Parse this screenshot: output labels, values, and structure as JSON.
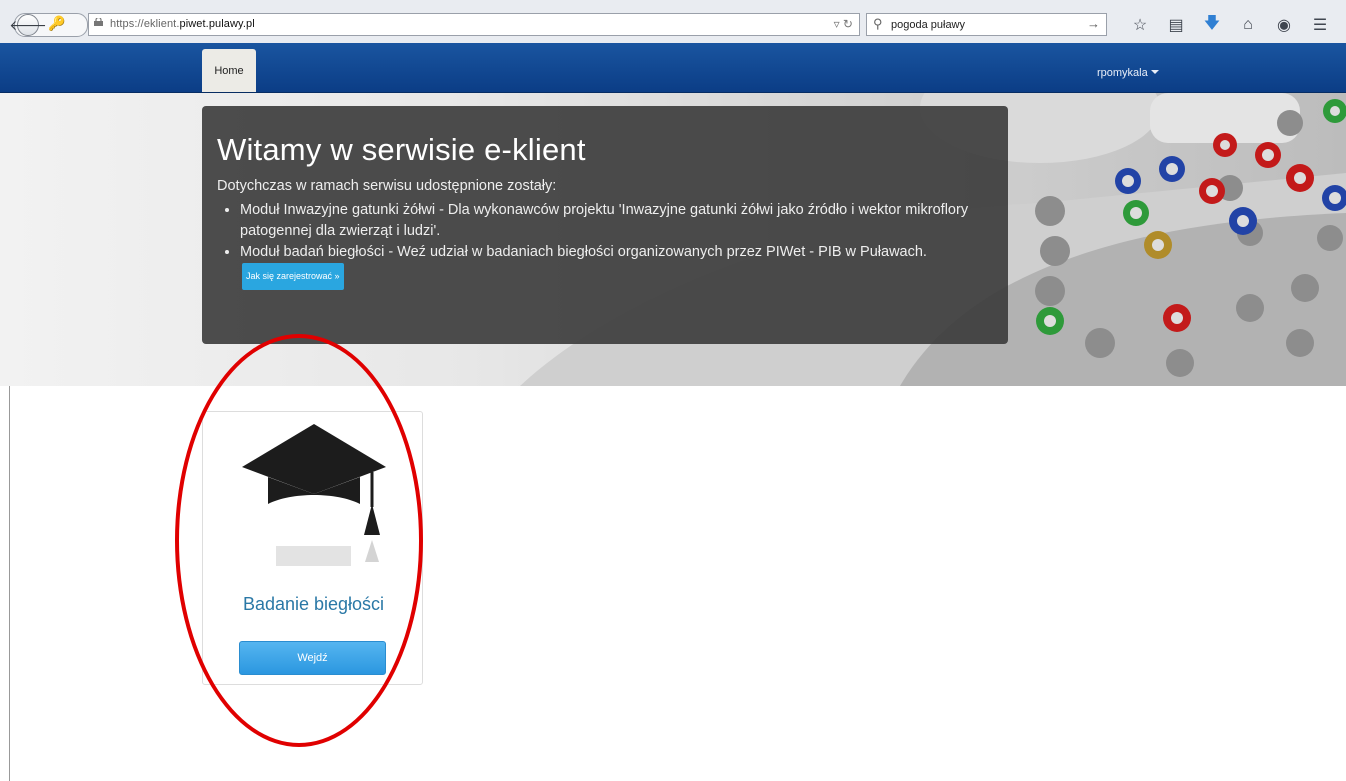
{
  "browser": {
    "url_prefix": "https://eklient.",
    "url_domain": "piwet.pulawy.pl",
    "search_query": "pogoda puławy"
  },
  "navbar": {
    "home_label": "Home",
    "user_label": "rpomykala"
  },
  "hero": {
    "title": "Witamy w serwisie e-klient",
    "lead": "Dotychczas w ramach serwisu udostępnione zostały:",
    "items": [
      "Moduł Inwazyjne gatunki żółwi - Dla wykonawców projektu 'Inwazyjne gatunki żółwi jako źródło i wektor mikroflory patogennej dla zwierząt i ludzi'.",
      "Moduł badań biegłości - Weź udział w badaniach biegłości organizowanych przez PIWet - PIB w Puławach."
    ],
    "register_button": "Jak się zarejestrować »"
  },
  "card": {
    "title": "Badanie biegłości",
    "button_label": "Wejdź"
  },
  "colors": {
    "navbar": "#0b3d86",
    "card_title": "#2a78a6",
    "button": "#2b97e0",
    "annotation": "#e00000"
  }
}
